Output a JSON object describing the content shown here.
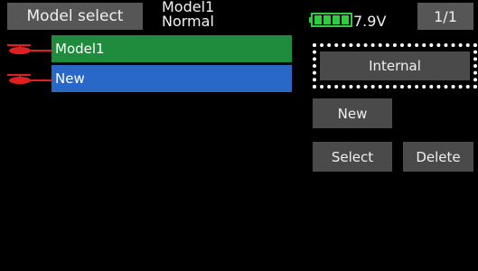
{
  "header": {
    "screen_title": "Model select",
    "model_name": "Model1",
    "condition": "Normal",
    "voltage": "7.9V",
    "page": "1/1"
  },
  "model_list": {
    "items": [
      {
        "label": "Model1",
        "color": "#1e8c3c",
        "icon": "helicopter-icon"
      },
      {
        "label": "New",
        "color": "#2a68c8",
        "icon": "helicopter-icon"
      }
    ]
  },
  "actions": {
    "memory_label": "Internal",
    "new_label": "New",
    "select_label": "Select",
    "delete_label": "Delete"
  },
  "colors": {
    "background": "#000000",
    "button": "#4a4a4a",
    "header_button": "#565656",
    "battery": "#2ecc40",
    "icon": "#e02020"
  }
}
